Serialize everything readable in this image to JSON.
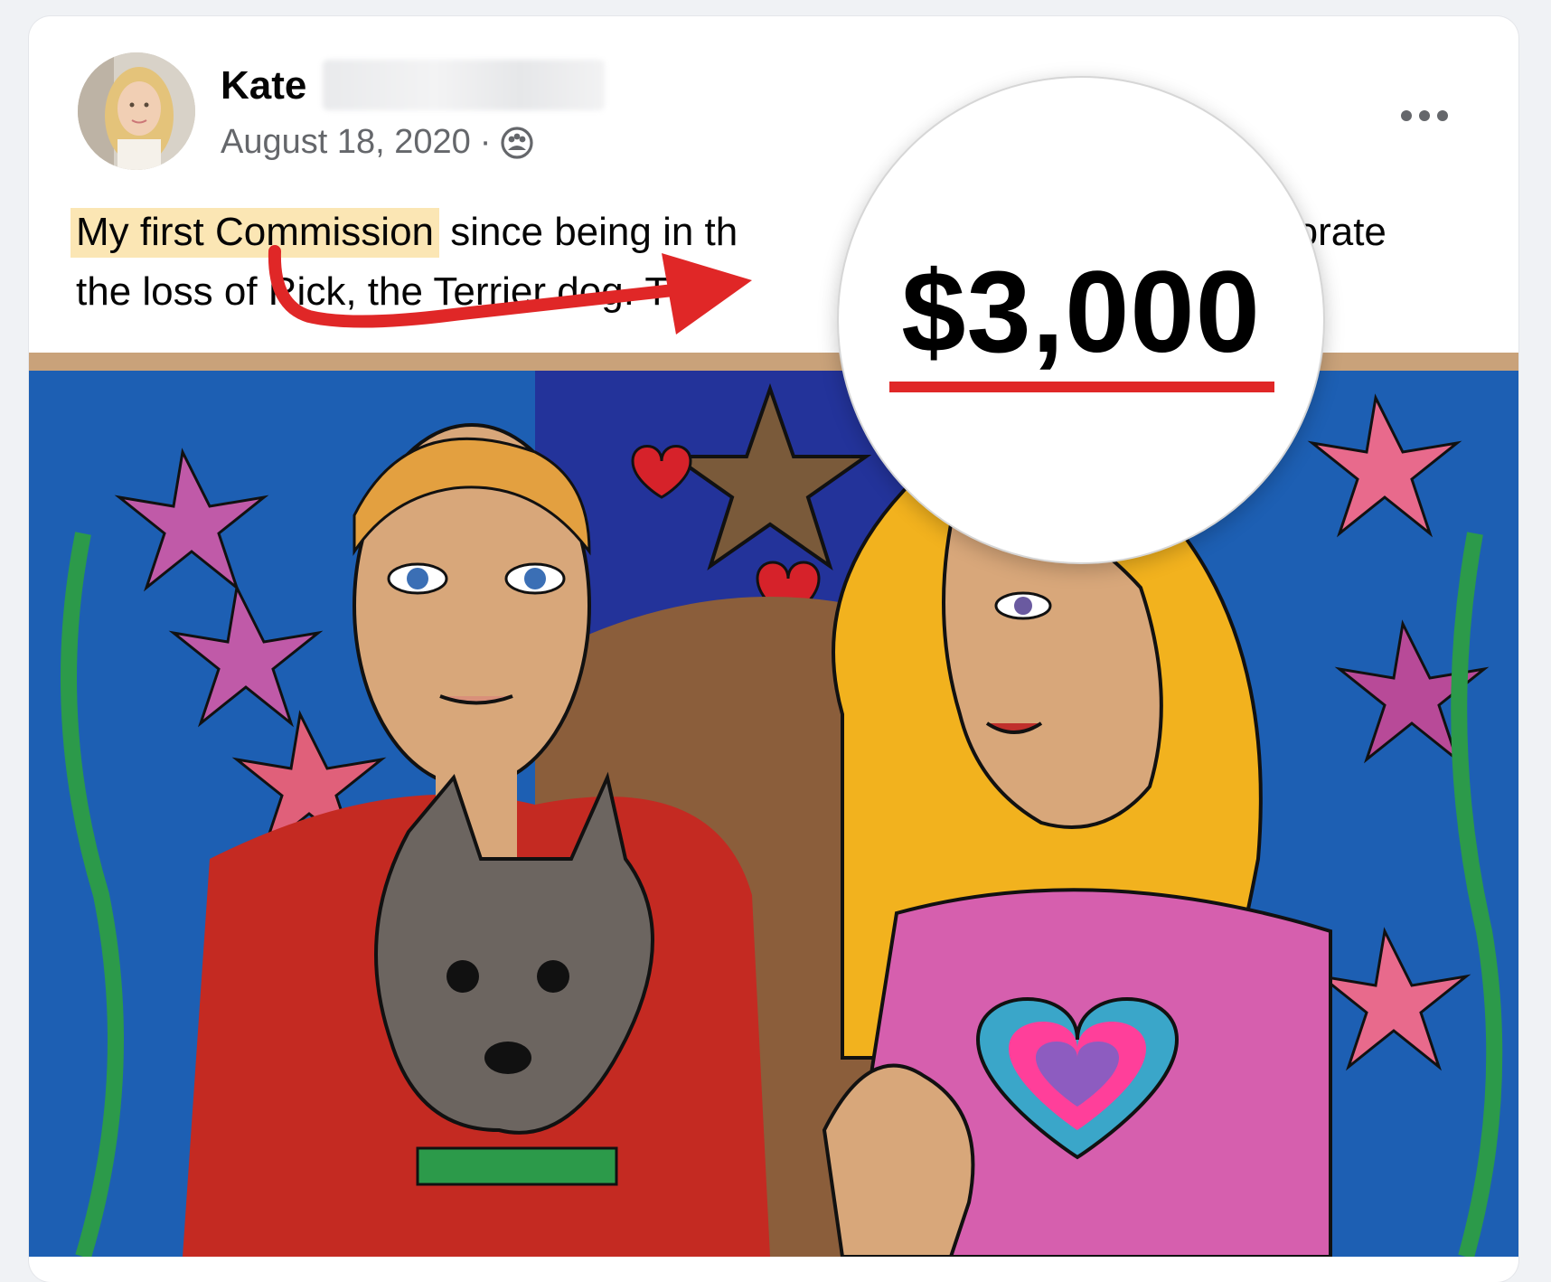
{
  "post": {
    "author_name": "Kate",
    "date": "August 18, 2020",
    "separator": "·",
    "audience_icon": "group-icon",
    "more_icon": "more-options-icon",
    "text_highlight": "My first Commission",
    "text_line1_rest": " since being in th",
    "text_line1_end": "nemorate",
    "text_line2": "the loss of Rick, the Terrier dog. Thi",
    "image_description_icon": "painting-image"
  },
  "callout": {
    "price": "$3,000",
    "accent_color": "#e02727",
    "highlight_color": "#fbe6b4"
  }
}
